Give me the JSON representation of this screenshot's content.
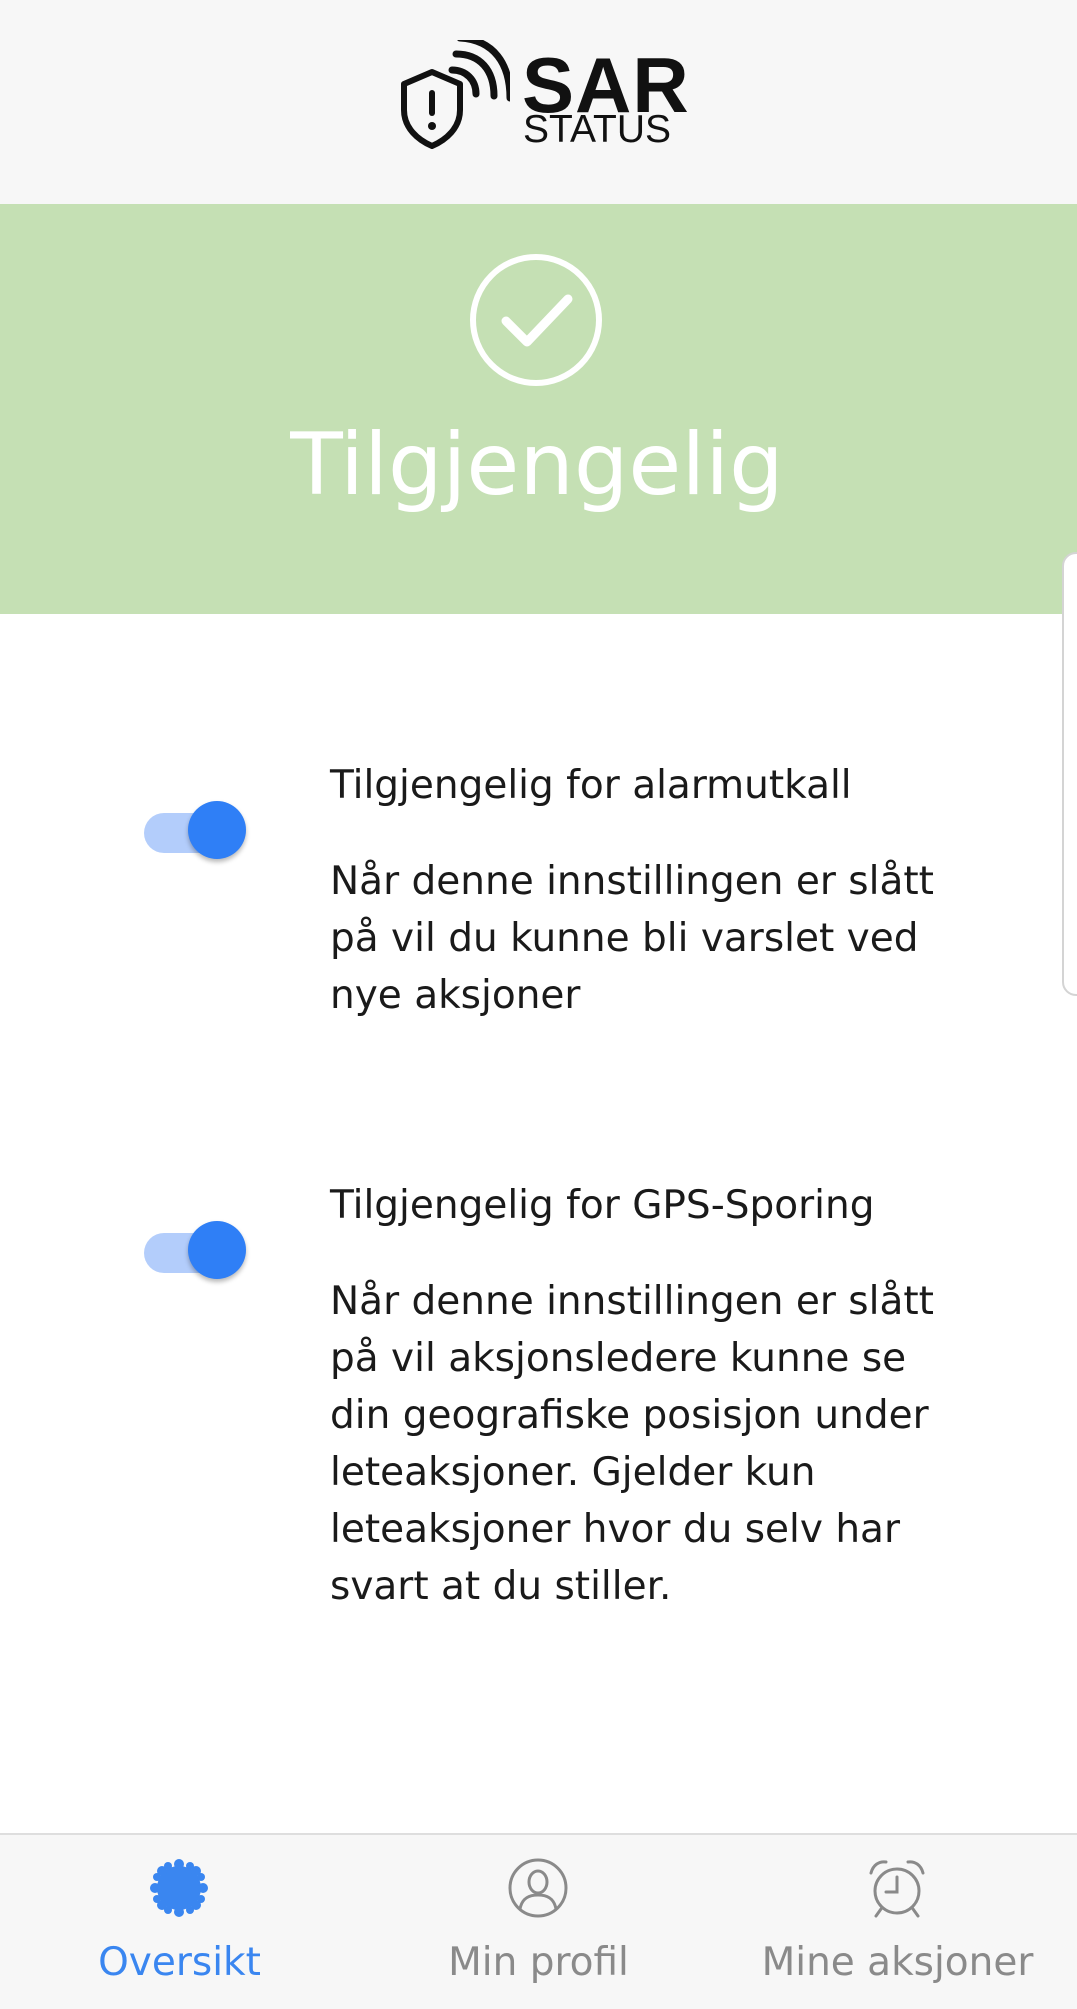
{
  "header": {
    "logo_text": "SAR",
    "logo_subtext": "STATUS",
    "logo_icon": "shield-exclamation-signal-icon"
  },
  "status": {
    "icon": "checkmark-circle-icon",
    "title": "Tilgjengelig",
    "background_color": "#c5e0b4"
  },
  "settings": [
    {
      "title": "Tilgjengelig for alarmutkall",
      "description_lines": [
        "Når denne innstillingen er slått",
        "på vil du kunne bli varslet ved",
        "nye aksjoner"
      ],
      "enabled": true
    },
    {
      "title": "Tilgjengelig for GPS-Sporing",
      "description_lines": [
        "Når denne innstillingen er slått",
        "på vil aksjonsledere kunne se",
        "din geografiske posisjon under",
        "leteaksjoner. Gjelder kun",
        "leteaksjoner hvor du selv har",
        "svart at du stiller."
      ],
      "enabled": true
    }
  ],
  "tabbar": {
    "tabs": [
      {
        "label": "Oversikt",
        "icon": "overview-badge-icon",
        "active": true
      },
      {
        "label": "Min profil",
        "icon": "profile-person-icon",
        "active": false
      },
      {
        "label": "Mine aksjoner",
        "icon": "alarm-clock-icon",
        "active": false
      }
    ],
    "active_color": "#3a86f0",
    "inactive_color": "#8a8a8a"
  },
  "colors": {
    "toggle_on_thumb": "#2f7ff6",
    "toggle_on_track": "#b3cdfb"
  }
}
